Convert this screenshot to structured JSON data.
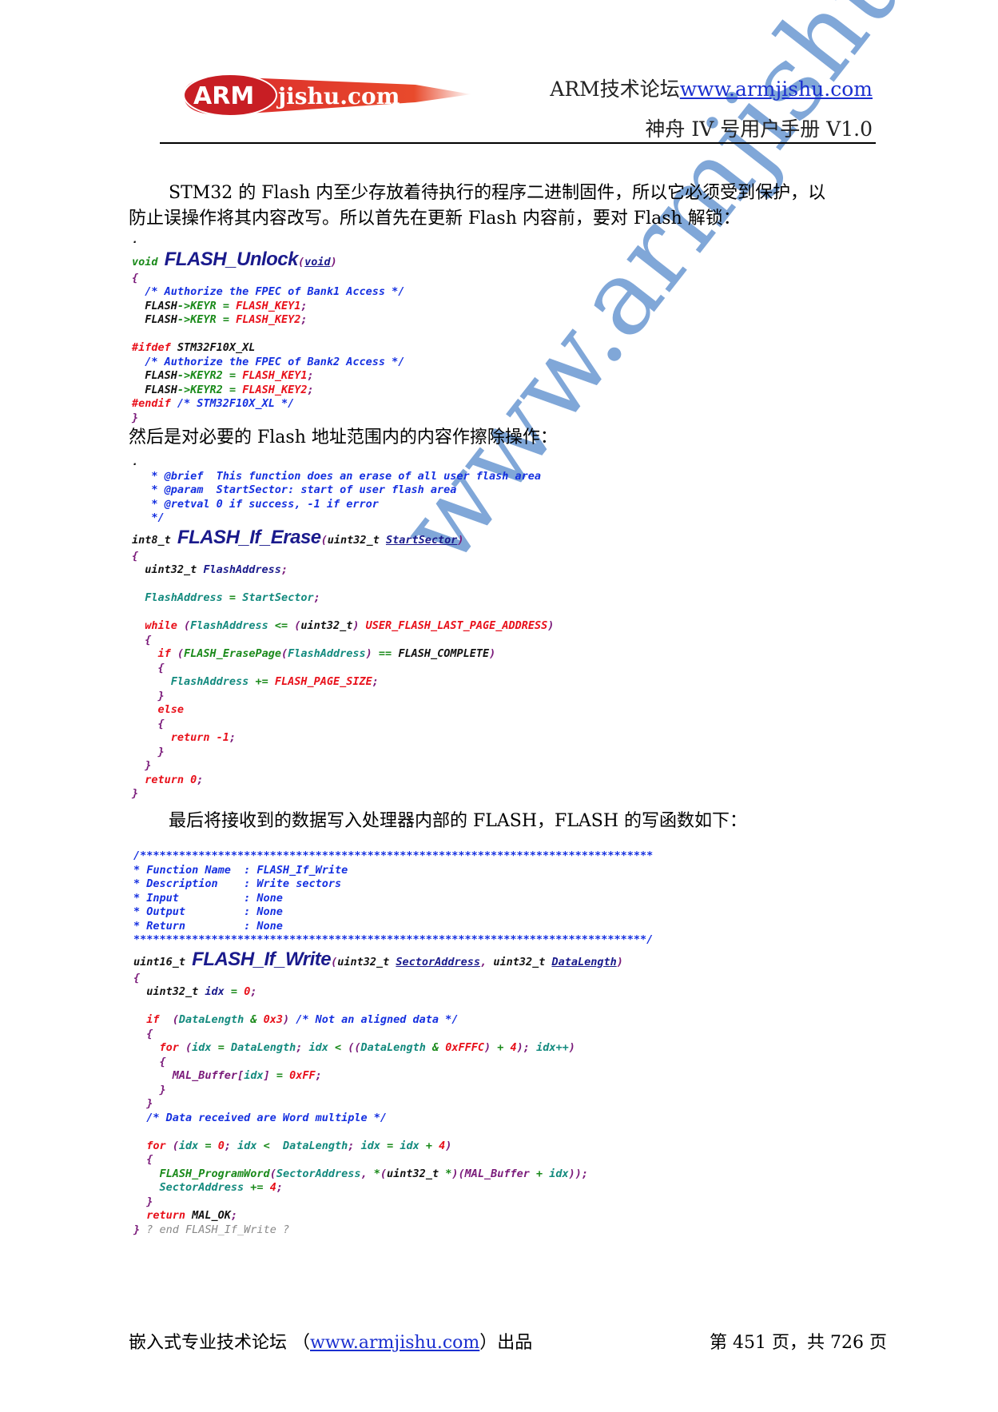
{
  "header": {
    "logo_text": "ARMjishu.com",
    "forum_label": "ARM技术论坛",
    "forum_url": "www.armjishu.com",
    "manual_title": "神舟 IV 号用户手册  V1.0"
  },
  "watermark": "www.armjishu.com",
  "body": {
    "para1_line1": "STM32 的 Flash 内至少存放着待执行的程序二进制固件，所以它必须受到保护，以",
    "para1_line2": "防止误操作将其内容改写。所以首先在更新 Flash 内容前，要对 Flash 解锁：",
    "para2": "然后是对必要的 Flash 地址范围内的内容作擦除操作：",
    "para3": "最后将接收到的数据写入处理器内部的 FLASH，FLASH 的写函数如下："
  },
  "code_blocks": [
    [
      [
        [
          ".",
          "b"
        ]
      ],
      [
        [
          "void ",
          "g"
        ],
        [
          "FLASH_Unlock",
          "fn"
        ],
        [
          "(",
          "p"
        ],
        [
          "void",
          "nu"
        ],
        [
          ")",
          "p"
        ]
      ],
      [
        [
          "{",
          "p"
        ]
      ],
      [
        [
          "  /* Authorize the FPEC of Bank1 Access */",
          "c"
        ]
      ],
      [
        [
          "  FLASH",
          "b"
        ],
        [
          "->",
          "g"
        ],
        [
          "KEYR",
          "g"
        ],
        [
          " = ",
          "g"
        ],
        [
          "FLASH_KEY1",
          "k"
        ],
        [
          ";",
          "p"
        ]
      ],
      [
        [
          "  FLASH",
          "b"
        ],
        [
          "->",
          "g"
        ],
        [
          "KEYR",
          "g"
        ],
        [
          " = ",
          "g"
        ],
        [
          "FLASH_KEY2",
          "k"
        ],
        [
          ";",
          "p"
        ]
      ],
      [],
      [
        [
          "#ifdef ",
          "k"
        ],
        [
          "STM32F10X_XL",
          "b"
        ]
      ],
      [
        [
          "  /* Authorize the FPEC of Bank2 Access */",
          "c"
        ]
      ],
      [
        [
          "  FLASH",
          "b"
        ],
        [
          "->",
          "g"
        ],
        [
          "KEYR2",
          "g"
        ],
        [
          " = ",
          "g"
        ],
        [
          "FLASH_KEY1",
          "k"
        ],
        [
          ";",
          "p"
        ]
      ],
      [
        [
          "  FLASH",
          "b"
        ],
        [
          "->",
          "g"
        ],
        [
          "KEYR2",
          "g"
        ],
        [
          " = ",
          "g"
        ],
        [
          "FLASH_KEY2",
          "k"
        ],
        [
          ";",
          "p"
        ]
      ],
      [
        [
          "#endif ",
          "k"
        ],
        [
          "/* STM32F10X_XL */",
          "c"
        ]
      ],
      [
        [
          "}",
          "p"
        ]
      ]
    ],
    [
      [
        [
          ".",
          "b"
        ]
      ],
      [
        [
          "   * @brief  This function does an erase of all user flash area",
          "c"
        ]
      ],
      [
        [
          "   * @param  StartSector: start of user flash area",
          "c"
        ]
      ],
      [
        [
          "   * @retval 0 if success, -1 if error",
          "c"
        ]
      ],
      [
        [
          "   */",
          "c"
        ]
      ],
      [
        [
          "int8_t ",
          "b"
        ],
        [
          "FLASH_If_Erase",
          "fn"
        ],
        [
          "(",
          "p"
        ],
        [
          "uint32_t ",
          "b"
        ],
        [
          "StartSector",
          "nu"
        ],
        [
          ")",
          "p"
        ]
      ],
      [
        [
          "{",
          "p"
        ]
      ],
      [
        [
          "  uint32_t ",
          "b"
        ],
        [
          "FlashAddress",
          "n"
        ],
        [
          ";",
          "p"
        ]
      ],
      [],
      [
        [
          "  FlashAddress",
          "t"
        ],
        [
          " = ",
          "g"
        ],
        [
          "StartSector",
          "t"
        ],
        [
          ";",
          "p"
        ]
      ],
      [],
      [
        [
          "  while ",
          "k"
        ],
        [
          "(",
          "p"
        ],
        [
          "FlashAddress",
          "t"
        ],
        [
          " <= ",
          "g"
        ],
        [
          "(",
          "p"
        ],
        [
          "uint32_t",
          "b"
        ],
        [
          ") ",
          "p"
        ],
        [
          "USER_FLASH_LAST_PAGE_ADDRESS",
          "k"
        ],
        [
          ")",
          "p"
        ]
      ],
      [
        [
          "  {",
          "p"
        ]
      ],
      [
        [
          "    if ",
          "k"
        ],
        [
          "(",
          "p"
        ],
        [
          "FLASH_ErasePage",
          "g"
        ],
        [
          "(",
          "p"
        ],
        [
          "FlashAddress",
          "t"
        ],
        [
          ") ",
          "p"
        ],
        [
          "== ",
          "g"
        ],
        [
          "FLASH_COMPLETE",
          "b"
        ],
        [
          ")",
          "p"
        ]
      ],
      [
        [
          "    {",
          "p"
        ]
      ],
      [
        [
          "      FlashAddress",
          "t"
        ],
        [
          " += ",
          "g"
        ],
        [
          "FLASH_PAGE_SIZE",
          "k"
        ],
        [
          ";",
          "p"
        ]
      ],
      [
        [
          "    }",
          "p"
        ]
      ],
      [
        [
          "    else",
          "k"
        ]
      ],
      [
        [
          "    {",
          "p"
        ]
      ],
      [
        [
          "      return ",
          "k"
        ],
        [
          "-1",
          "k"
        ],
        [
          ";",
          "p"
        ]
      ],
      [
        [
          "    }",
          "p"
        ]
      ],
      [
        [
          "  }",
          "p"
        ]
      ],
      [
        [
          "  return ",
          "k"
        ],
        [
          "0",
          "k"
        ],
        [
          ";",
          "p"
        ]
      ],
      [
        [
          "}",
          "p"
        ]
      ]
    ],
    [
      [
        [
          "/*******************************************************************************",
          "c"
        ]
      ],
      [
        [
          "* Function Name  : FLASH_If_Write",
          "c"
        ]
      ],
      [
        [
          "* Description    : Write sectors",
          "c"
        ]
      ],
      [
        [
          "* Input          : None",
          "c"
        ]
      ],
      [
        [
          "* Output         : None",
          "c"
        ]
      ],
      [
        [
          "* Return         : None",
          "c"
        ]
      ],
      [
        [
          "*******************************************************************************/",
          "c"
        ]
      ],
      [
        [
          "uint16_t ",
          "b"
        ],
        [
          "FLASH_If_Write",
          "fn"
        ],
        [
          "(",
          "p"
        ],
        [
          "uint32_t ",
          "b"
        ],
        [
          "SectorAddress",
          "nu"
        ],
        [
          ", ",
          "p"
        ],
        [
          "uint32_t ",
          "b"
        ],
        [
          "DataLength",
          "nu"
        ],
        [
          ")",
          "p"
        ]
      ],
      [
        [
          "{",
          "p"
        ]
      ],
      [
        [
          "  uint32_t ",
          "b"
        ],
        [
          "idx",
          "n"
        ],
        [
          " = ",
          "g"
        ],
        [
          "0",
          "k"
        ],
        [
          ";",
          "p"
        ]
      ],
      [],
      [
        [
          "  if  ",
          "k"
        ],
        [
          "(",
          "p"
        ],
        [
          "DataLength",
          "t"
        ],
        [
          " & ",
          "g"
        ],
        [
          "0x3",
          "k"
        ],
        [
          ") ",
          "p"
        ],
        [
          "/* Not an aligned data */",
          "c"
        ]
      ],
      [
        [
          "  {",
          "p"
        ]
      ],
      [
        [
          "    for ",
          "k"
        ],
        [
          "(",
          "p"
        ],
        [
          "idx",
          "t"
        ],
        [
          " = ",
          "g"
        ],
        [
          "DataLength",
          "t"
        ],
        [
          "; ",
          "p"
        ],
        [
          "idx",
          "t"
        ],
        [
          " < ",
          "g"
        ],
        [
          "((",
          "p"
        ],
        [
          "DataLength",
          "t"
        ],
        [
          " & ",
          "g"
        ],
        [
          "0xFFFC",
          "k"
        ],
        [
          ") ",
          "p"
        ],
        [
          "+ ",
          "g"
        ],
        [
          "4",
          "k"
        ],
        [
          "); ",
          "p"
        ],
        [
          "idx++",
          "t"
        ],
        [
          ")",
          "p"
        ]
      ],
      [
        [
          "    {",
          "p"
        ]
      ],
      [
        [
          "      MAL_Buffer",
          "p"
        ],
        [
          "[",
          "p"
        ],
        [
          "idx",
          "t"
        ],
        [
          "]",
          "p"
        ],
        [
          " = ",
          "g"
        ],
        [
          "0xFF",
          "k"
        ],
        [
          ";",
          "p"
        ]
      ],
      [
        [
          "    }",
          "p"
        ]
      ],
      [
        [
          "  }",
          "p"
        ]
      ],
      [
        [
          "  /* Data received are Word multiple */",
          "c"
        ]
      ],
      [],
      [
        [
          "  for ",
          "k"
        ],
        [
          "(",
          "p"
        ],
        [
          "idx",
          "t"
        ],
        [
          " = ",
          "g"
        ],
        [
          "0",
          "k"
        ],
        [
          "; ",
          "p"
        ],
        [
          "idx",
          "t"
        ],
        [
          " <  ",
          "g"
        ],
        [
          "DataLength",
          "t"
        ],
        [
          "; ",
          "p"
        ],
        [
          "idx",
          "t"
        ],
        [
          " = ",
          "g"
        ],
        [
          "idx",
          "t"
        ],
        [
          " + ",
          "g"
        ],
        [
          "4",
          "k"
        ],
        [
          ")",
          "p"
        ]
      ],
      [
        [
          "  {",
          "p"
        ]
      ],
      [
        [
          "    FLASH_ProgramWord",
          "g"
        ],
        [
          "(",
          "p"
        ],
        [
          "SectorAddress",
          "t"
        ],
        [
          ", ",
          "p"
        ],
        [
          "*",
          "g"
        ],
        [
          "(",
          "p"
        ],
        [
          "uint32_t ",
          "b"
        ],
        [
          "*",
          "g"
        ],
        [
          ")(",
          "p"
        ],
        [
          "MAL_Buffer",
          "p"
        ],
        [
          " + ",
          "g"
        ],
        [
          "idx",
          "t"
        ],
        [
          "));",
          "p"
        ]
      ],
      [
        [
          "    SectorAddress",
          "t"
        ],
        [
          " += ",
          "g"
        ],
        [
          "4",
          "k"
        ],
        [
          ";",
          "p"
        ]
      ],
      [
        [
          "  }",
          "p"
        ]
      ],
      [
        [
          "  return ",
          "k"
        ],
        [
          "MAL_OK",
          "b"
        ],
        [
          ";",
          "p"
        ]
      ],
      [
        [
          "} ",
          "p"
        ],
        [
          "? end FLASH_If_Write ?",
          "gr"
        ]
      ]
    ]
  ],
  "footer": {
    "left_prefix": "嵌入式专业技术论坛  （",
    "url": "www.armjishu.com",
    "left_suffix": "）出品",
    "page_info": "第 451 页，共 726 页"
  },
  "colors": {
    "logo_red": "#d8262c",
    "link_blue": "#1a2fd0",
    "watermark": "#6b98d2"
  }
}
